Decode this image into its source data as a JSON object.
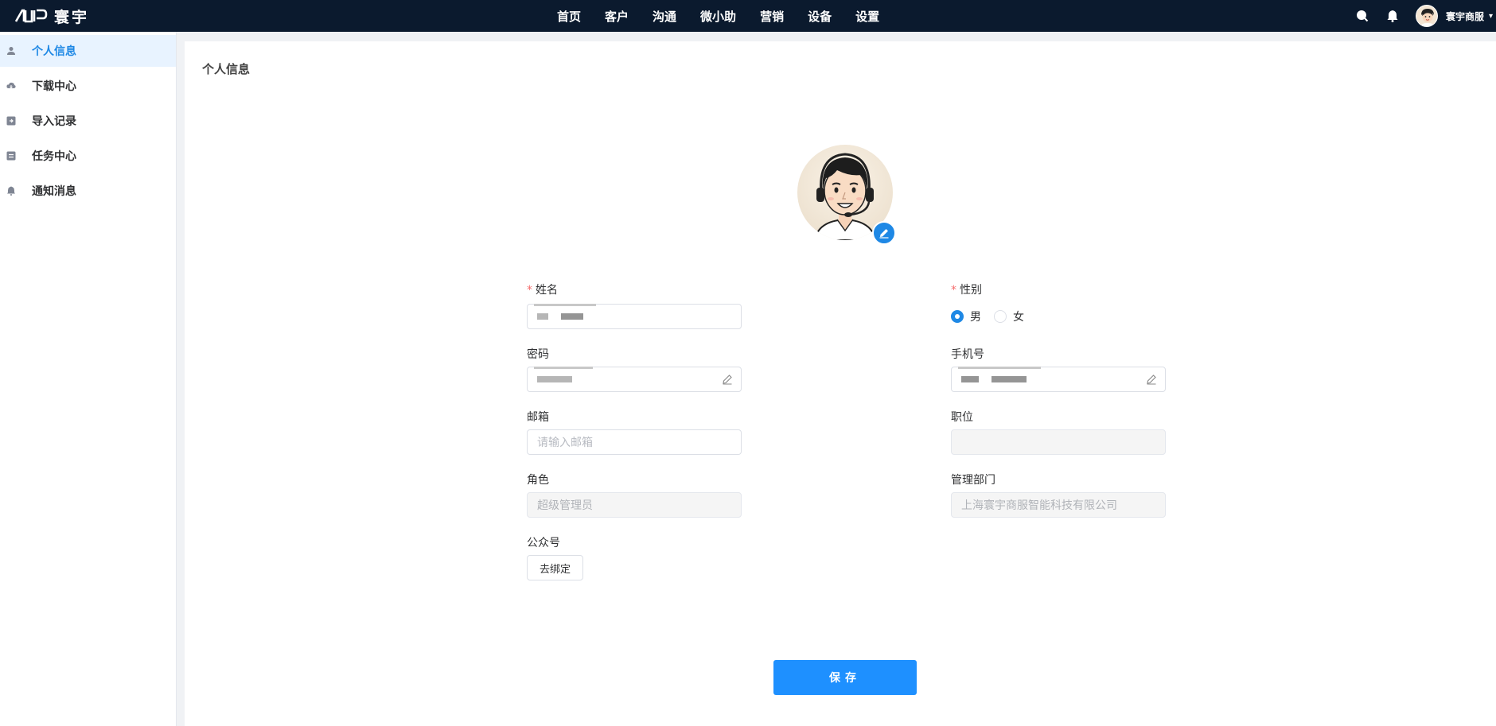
{
  "app": {
    "logo_text": "寰宇"
  },
  "nav": {
    "items": [
      "首页",
      "客户",
      "沟通",
      "微小助",
      "营销",
      "设备",
      "设置"
    ]
  },
  "header_right": {
    "icons": [
      "search-icon",
      "bell-icon"
    ],
    "username": "寰宇商服",
    "caret": "▾"
  },
  "sidebar": {
    "items": [
      {
        "label": "个人信息",
        "icon": "user-icon",
        "active": true
      },
      {
        "label": "下载中心",
        "icon": "cloud-download-icon",
        "active": false
      },
      {
        "label": "导入记录",
        "icon": "import-icon",
        "active": false
      },
      {
        "label": "任务中心",
        "icon": "task-icon",
        "active": false
      },
      {
        "label": "通知消息",
        "icon": "bell-icon",
        "active": false
      }
    ]
  },
  "page": {
    "title": "个人信息"
  },
  "form": {
    "name_label": "姓名",
    "gender_label": "性别",
    "gender_options": [
      "男",
      "女"
    ],
    "gender_selected": "男",
    "password_label": "密码",
    "phone_label": "手机号",
    "email_label": "邮箱",
    "email_placeholder": "请输入邮箱",
    "position_label": "职位",
    "position_value": "",
    "role_label": "角色",
    "role_value": "超级管理员",
    "department_label": "管理部门",
    "department_value": "上海寰宇商服智能科技有限公司",
    "wechat_label": "公众号",
    "bind_button": "去绑定",
    "required_mark": "*"
  },
  "actions": {
    "save_label": "保存"
  },
  "colors": {
    "topbar": "#0b1a2e",
    "accent": "#1e88e5",
    "save_button": "#1e90ff",
    "required": "#f56c6c"
  }
}
